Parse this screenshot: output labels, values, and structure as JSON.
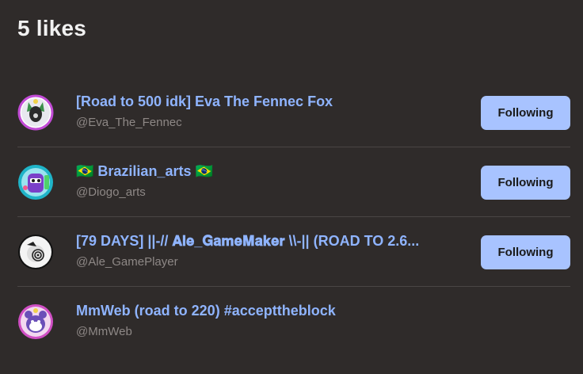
{
  "header": {
    "title": "5 likes"
  },
  "users": [
    {
      "name": "[Road to 500 idk] Eva The Fennec Fox",
      "handle": "@Eva_The_Fennec",
      "button": "Following",
      "avatar_icon": "fox-avatar-icon"
    },
    {
      "name": "🇧🇷 Brazilian_arts 🇧🇷",
      "handle": "@Diogo_arts",
      "button": "Following",
      "avatar_icon": "purple-character-avatar-icon"
    },
    {
      "name": "[79 DAYS] ||-// 𝐀𝐥𝐞_𝐆𝐚𝐦𝐞𝐌𝐚𝐤𝐞𝐫 \\\\-|| (ROAD TO 2.6...",
      "handle": "@Ale_GamePlayer",
      "button": "Following",
      "avatar_icon": "spiral-avatar-icon"
    },
    {
      "name": "MmWeb (road to 220) #accepttheblock",
      "handle": "@MmWeb",
      "avatar_icon": "bear-avatar-icon"
    }
  ],
  "colors": {
    "background": "#2f2b2a",
    "name": "#8fb4ff",
    "button": "#a8c3ff"
  }
}
